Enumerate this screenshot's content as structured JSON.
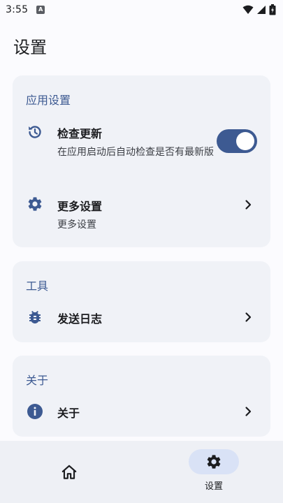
{
  "status_bar": {
    "time": "3:55",
    "notification_letter": "A"
  },
  "page": {
    "title": "设置"
  },
  "app_settings": {
    "header": "应用设置",
    "check_update": {
      "title": "检查更新",
      "subtitle": "在应用启动后自动检查是否有最新版",
      "enabled": true
    },
    "more_settings": {
      "title": "更多设置",
      "subtitle": "更多设置"
    }
  },
  "tools": {
    "header": "工具",
    "send_log": {
      "title": "发送日志"
    }
  },
  "about": {
    "header": "关于",
    "about_item": {
      "title": "关于"
    }
  },
  "bottom_nav": {
    "settings_label": "设置",
    "active": "settings"
  },
  "colors": {
    "accent": "#3d5a92",
    "card_bg": "#f0f2f7",
    "nav_pill": "#d9e2f6"
  }
}
